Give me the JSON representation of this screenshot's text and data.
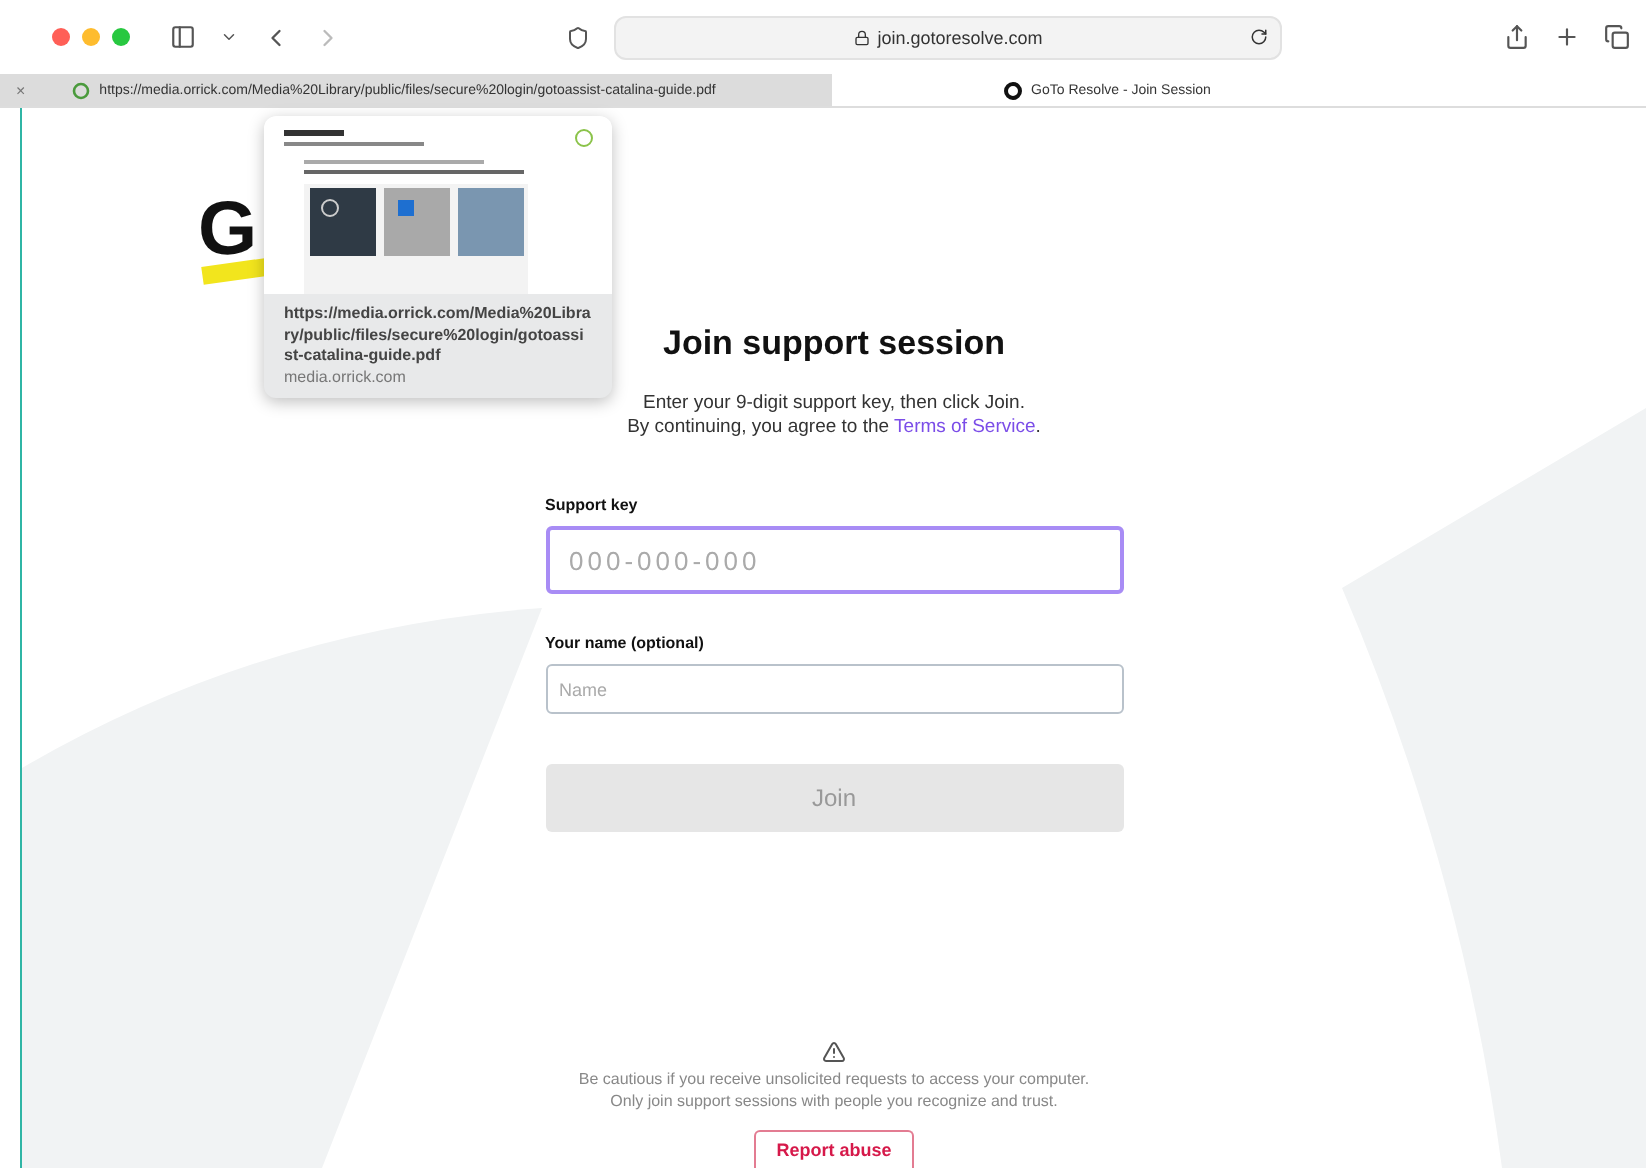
{
  "browser": {
    "address": "join.gotoresolve.com",
    "tabs": [
      {
        "title": "https://media.orrick.com/Media%20Library/public/files/secure%20login/gotoassist-catalina-guide.pdf",
        "selected": false,
        "close": "×"
      },
      {
        "title": "GoTo Resolve - Join Session",
        "selected": true
      }
    ]
  },
  "link_preview": {
    "url": "https://media.orrick.com/Media%20Library/public/files/secure%20login/gotoassist-catalina-guide.pdf",
    "domain": "media.orrick.com"
  },
  "logo": "G",
  "form": {
    "title": "Join support session",
    "intro": "Enter your 9-digit support key, then click Join.",
    "consent": "By continuing, you agree to the",
    "consent_link": "Terms of Service",
    "consent_end": ".",
    "fields": [
      {
        "label": "Support key",
        "placeholder": "000-000-000",
        "focused": true
      },
      {
        "label": "Your name (optional)",
        "placeholder": "Name",
        "focused": false
      }
    ],
    "submit": {
      "label": "Join",
      "disabled": true
    }
  },
  "warning": {
    "lines": [
      "Be cautious if you receive unsolicited requests to access your computer.",
      "Only join support sessions with people you recognize and trust."
    ],
    "report": "Report abuse"
  }
}
